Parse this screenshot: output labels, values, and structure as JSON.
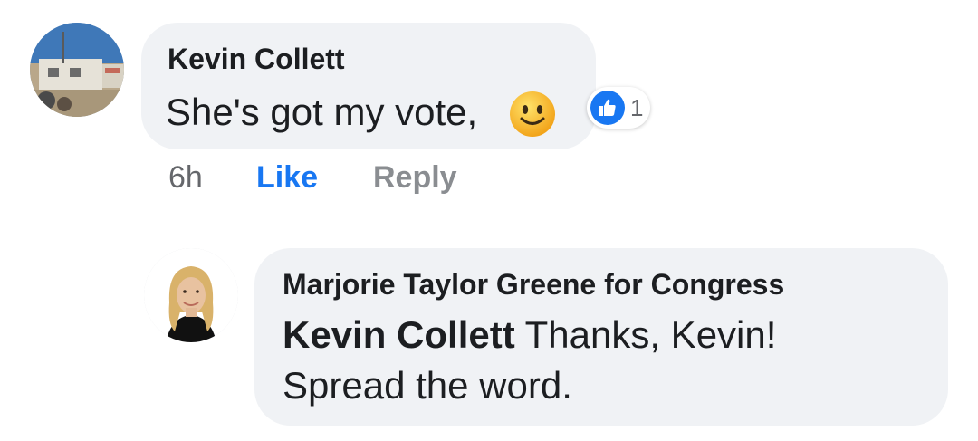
{
  "comment": {
    "author": "Kevin Collett",
    "text": "She's got my vote,",
    "emoji": "slightly-smiling-face",
    "reaction": {
      "icon": "thumbs-up-icon",
      "count": "1"
    },
    "meta": {
      "time": "6h",
      "like_label": "Like",
      "reply_label": "Reply"
    }
  },
  "reply": {
    "author": "Marjorie Taylor Greene for Congress",
    "mention": "Kevin Collett",
    "text_line1": " Thanks, Kevin!",
    "text_line2": "Spread the word."
  },
  "colors": {
    "bubble": "#f0f2f5",
    "like_blue": "#1877f2",
    "text": "#1c1e21",
    "meta_gray": "#65676b"
  }
}
